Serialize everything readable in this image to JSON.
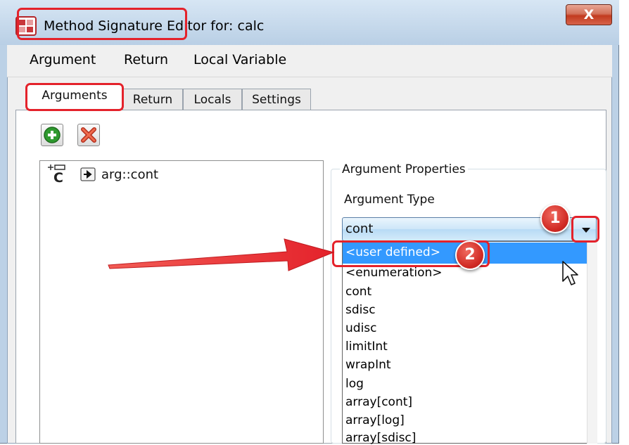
{
  "window": {
    "title": "Method Signature Editor for: calc",
    "close_symbol": "X"
  },
  "menubar": [
    "Argument",
    "Return",
    "Local Variable"
  ],
  "tabs": [
    "Arguments",
    "Return",
    "Locals",
    "Settings"
  ],
  "toolbar": {
    "add_icon": "green-plus-icon",
    "delete_icon": "red-x-delete-icon"
  },
  "arguments": [
    {
      "name": "arg::cont",
      "icon": "class-c-icon",
      "direction_icon": "input-arrow-icon"
    }
  ],
  "properties": {
    "group_title": "Argument Properties",
    "type_label": "Argument Type",
    "type_value": "cont",
    "options": [
      "<user defined>",
      "<enumeration>",
      "cont",
      "sdisc",
      "udisc",
      "limitInt",
      "wrapInt",
      "log",
      "array[cont]",
      "array[log]",
      "array[sdisc]"
    ],
    "highlighted_option": "<user defined>"
  },
  "annotations": {
    "callout_1": "1",
    "callout_2": "2",
    "accent_color": "#e4222b"
  }
}
